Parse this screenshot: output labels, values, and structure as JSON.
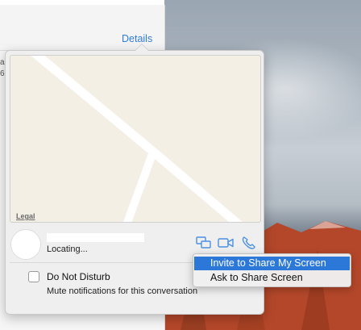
{
  "window": {
    "details_label": "Details",
    "left_fragments": [
      "a",
      "6"
    ]
  },
  "map": {
    "legal_label": "Legal"
  },
  "contact": {
    "status": "Locating..."
  },
  "actions": {
    "icons": [
      "screen-share-icon",
      "video-camera-icon",
      "phone-icon"
    ],
    "accent_color": "#4a90e2"
  },
  "do_not_disturb": {
    "label": "Do Not Disturb",
    "description": "Mute notifications for this conversation",
    "checked": false
  },
  "share_menu": {
    "items": [
      {
        "label": "Invite to Share My Screen",
        "selected": true
      },
      {
        "label": "Ask to Share Screen",
        "selected": false
      }
    ],
    "highlight_color": "#2b78d9"
  }
}
